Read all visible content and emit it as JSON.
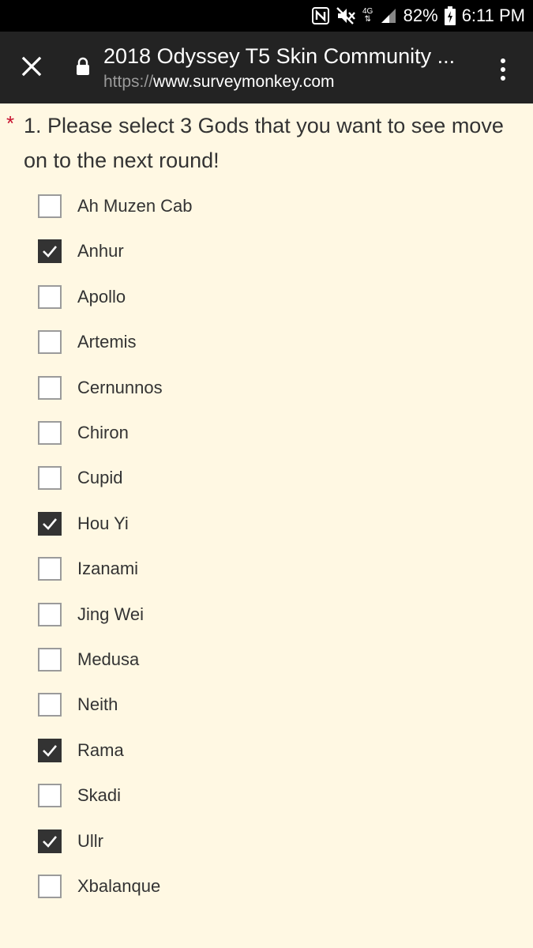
{
  "status_bar": {
    "battery": "82%",
    "time": "6:11 PM",
    "network": "4G",
    "icons": [
      "nfc-icon",
      "mute-icon",
      "network-4g-icon",
      "signal-icon",
      "battery-icon"
    ]
  },
  "browser": {
    "title": "2018 Odyssey T5 Skin Community ...",
    "url_scheme": "https://",
    "url_host": "www.surveymonkey.com",
    "icons": [
      "close-icon",
      "lock-icon",
      "overflow-menu-icon"
    ]
  },
  "question": {
    "required_marker": "*",
    "text": "1. Please select 3 Gods that you want to see move on to the next round!",
    "options": [
      {
        "label": "Ah Muzen Cab",
        "checked": false
      },
      {
        "label": "Anhur",
        "checked": true
      },
      {
        "label": "Apollo",
        "checked": false
      },
      {
        "label": "Artemis",
        "checked": false
      },
      {
        "label": "Cernunnos",
        "checked": false
      },
      {
        "label": "Chiron",
        "checked": false
      },
      {
        "label": "Cupid",
        "checked": false
      },
      {
        "label": "Hou Yi",
        "checked": true
      },
      {
        "label": "Izanami",
        "checked": false
      },
      {
        "label": "Jing Wei",
        "checked": false
      },
      {
        "label": "Medusa",
        "checked": false
      },
      {
        "label": "Neith",
        "checked": false
      },
      {
        "label": "Rama",
        "checked": true
      },
      {
        "label": "Skadi",
        "checked": false
      },
      {
        "label": "Ullr",
        "checked": true
      },
      {
        "label": "Xbalanque",
        "checked": false
      }
    ]
  },
  "colors": {
    "page_background": "#fff8e3",
    "toolbar_background": "#232323",
    "required": "#c8102e",
    "text": "#333333",
    "checkbox_checked": "#333333",
    "checkbox_border": "#9b9b9b"
  }
}
